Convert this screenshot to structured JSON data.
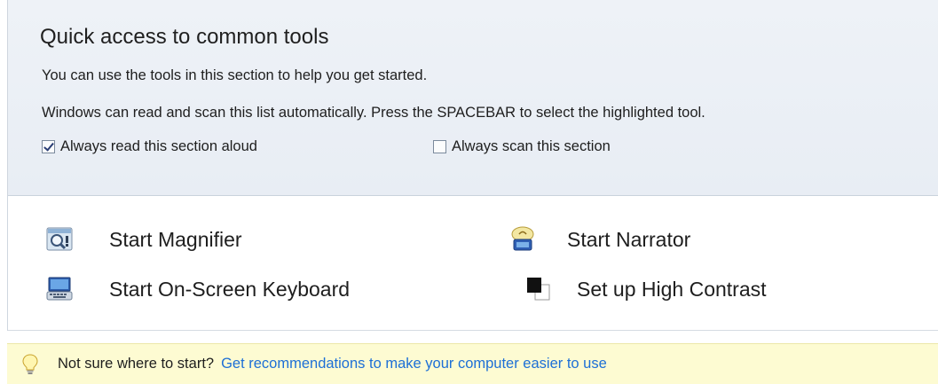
{
  "header": {
    "title": "Quick access to common tools",
    "line1": "You can use the tools in this section to help you get started.",
    "line2": "Windows can read and scan this list automatically.  Press the SPACEBAR to select the highlighted tool."
  },
  "options": {
    "read_aloud": {
      "label": "Always read this section aloud",
      "checked": true
    },
    "scan": {
      "label": "Always scan this section",
      "checked": false
    }
  },
  "tools": {
    "magnifier": {
      "label": "Start Magnifier",
      "icon": "magnifier-icon"
    },
    "narrator": {
      "label": "Start Narrator",
      "icon": "narrator-icon"
    },
    "keyboard": {
      "label": "Start On-Screen Keyboard",
      "icon": "keyboard-icon"
    },
    "contrast": {
      "label": "Set up High Contrast",
      "icon": "high-contrast-icon"
    }
  },
  "tip": {
    "text": "Not sure where to start?",
    "link": "Get recommendations to make your computer easier to use",
    "icon": "lightbulb-icon"
  },
  "colors": {
    "link": "#1d6fd6",
    "header_bg": "#eef2f7",
    "tip_bg": "#fdfbd2"
  }
}
